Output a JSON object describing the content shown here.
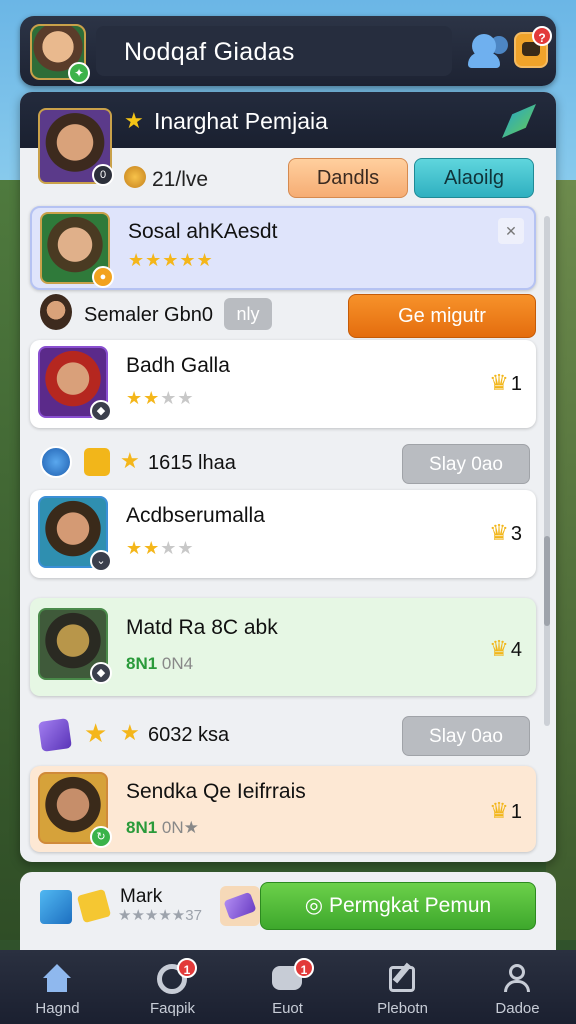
{
  "header": {
    "title": "Nodqaf Giadas",
    "gift_badge": "?"
  },
  "panel": {
    "title": "Inarghat Pemjaia",
    "coins": "21/lve",
    "btn_left": "Dandls",
    "btn_right": "Alaoilg"
  },
  "selected_card": {
    "name": "Sosal ahKAesdt",
    "stars": "★★★★★"
  },
  "semaler": {
    "label": "Semaler Gbn0",
    "tag": "nly",
    "button": "Ge migutr"
  },
  "cards": [
    {
      "name": "Badh Galla",
      "stars_on": "★★",
      "stars_off": "★★",
      "rank": "1"
    },
    {
      "name": "Acdbserumalla",
      "stars_on": "★★",
      "stars_off": "★★",
      "rank": "3"
    },
    {
      "name": "Matd Ra 8C abk",
      "sub_green": "8N1",
      "sub_gray": "0N4",
      "rank": "4"
    },
    {
      "name": "Sendka Qe Ieifrrais",
      "sub_green": "8N1",
      "sub_gray": "0N★",
      "rank": "1"
    }
  ],
  "rows": [
    {
      "label": "1615 lhaa",
      "button": "Slay 0ao"
    },
    {
      "label": "6032 ksa",
      "button": "Slay 0ao"
    }
  ],
  "bottom": {
    "label": "Mark",
    "stars": "★★★★★37",
    "button": "Permgkat Pemun"
  },
  "nav": [
    {
      "label": "Hagnd",
      "icon": "home-icon",
      "badge": ""
    },
    {
      "label": "Faqpik",
      "icon": "target-icon",
      "badge": "1"
    },
    {
      "label": "Euot",
      "icon": "chat-icon",
      "badge": "1"
    },
    {
      "label": "Plebotn",
      "icon": "edit-icon",
      "badge": ""
    },
    {
      "label": "Dadoe",
      "icon": "profile-icon",
      "badge": ""
    }
  ]
}
